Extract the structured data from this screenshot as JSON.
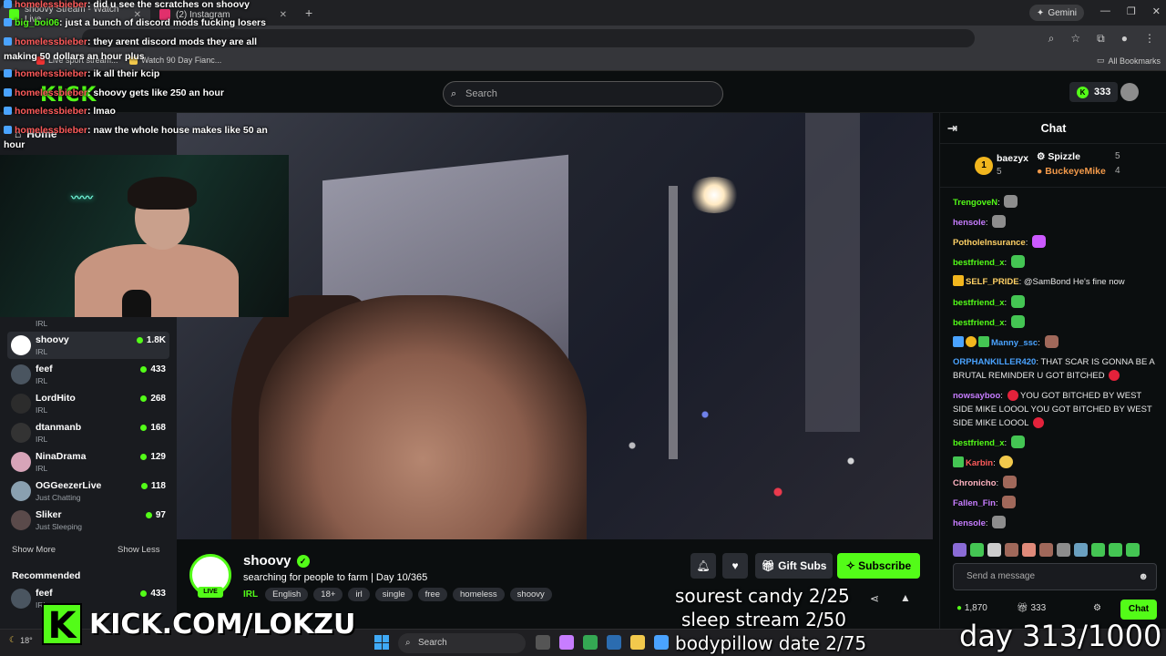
{
  "browser": {
    "tabs": [
      {
        "title": "shoovy Stream - Watch Live",
        "active": true
      },
      {
        "title": "(2) Instagram",
        "active": false
      }
    ],
    "gemini_label": "Gemini",
    "bookmarks": [
      "Live sport stream...",
      "Watch 90 Day Fianc...",
      "All Bookmarks"
    ]
  },
  "header": {
    "logo": "KICK",
    "search_placeholder": "Search",
    "points": "333"
  },
  "sidebar": {
    "home_label": "Home",
    "following": [
      {
        "name": "",
        "category": "IRL",
        "viewers": ""
      },
      {
        "name": "shoovy",
        "category": "IRL",
        "viewers": "1.8K",
        "active": true
      },
      {
        "name": "feef",
        "category": "IRL",
        "viewers": "433"
      },
      {
        "name": "LordHito",
        "category": "IRL",
        "viewers": "268"
      },
      {
        "name": "dtanmanb",
        "category": "IRL",
        "viewers": "168"
      },
      {
        "name": "NinaDrama",
        "category": "IRL",
        "viewers": "129"
      },
      {
        "name": "OGGeezerLive",
        "category": "Just Chatting",
        "viewers": "118"
      },
      {
        "name": "Sliker",
        "category": "Just Sleeping",
        "viewers": "97"
      }
    ],
    "show_more": "Show More",
    "show_less": "Show Less",
    "recommended_title": "Recommended",
    "recommended": [
      {
        "name": "feef",
        "category": "IRL",
        "viewers": "433"
      }
    ]
  },
  "overlay_chat": [
    {
      "user": "homelessbieber",
      "text": "did u see the scratches on shoovy"
    },
    {
      "user": "big_boi06",
      "text": "just a bunch of discord mods fucking losers"
    },
    {
      "user": "homelessbieber",
      "text": "they arent discord mods they are all making 50 dollars an hour plus"
    },
    {
      "user": "homelessbieber",
      "text": "ik all their kcip"
    },
    {
      "user": "homelessbieber",
      "text": "shoovy gets like 250 an hour"
    },
    {
      "user": "homelessbieber",
      "text": "lmao"
    },
    {
      "user": "homelessbieber",
      "text": "naw the whole house makes like 50 an hour"
    }
  ],
  "stream": {
    "streamer": "shoovy",
    "title": "searching for people to farm | Day 10/365",
    "live_label": "LIVE",
    "category": "IRL",
    "tags": [
      "English",
      "18+",
      "irl",
      "single",
      "free",
      "homeless",
      "shoovy"
    ],
    "gift_label": "Gift Subs",
    "subscribe_label": "Subscribe"
  },
  "overlays": {
    "sourest_candy": "sourest candy 2/25",
    "sleep_stream": "sleep stream 2/50",
    "bodypillow": "bodypillow date 2/75",
    "day_counter": "day 313/1000",
    "kick_url": "KICK.COM/LOKZU"
  },
  "chat": {
    "title": "Chat",
    "leaderboard": [
      {
        "rank": "1",
        "name": "baezyx",
        "count": "5"
      },
      {
        "rank": "",
        "name": "Spizzle",
        "count": "5"
      },
      {
        "rank": "",
        "name": "BuckeyeMike",
        "count": "4"
      }
    ],
    "messages": [
      {
        "user": "TrengoveN",
        "text": "",
        "color": "#53fc18",
        "emote": "gray"
      },
      {
        "user": "hensole",
        "text": "",
        "color": "#c77dff",
        "emote": "gray"
      },
      {
        "user": "PotholeInsurance",
        "text": "",
        "color": "#ffd166",
        "emote": "pink"
      },
      {
        "user": "bestfriend_x",
        "text": "",
        "color": "#53fc18",
        "emote": "green"
      },
      {
        "user": "SELF_PRIDE",
        "text": "@SamBond He's fine now",
        "color": "#ffd166",
        "emote": ""
      },
      {
        "user": "bestfriend_x",
        "text": "",
        "color": "#53fc18",
        "emote": "green"
      },
      {
        "user": "bestfriend_x",
        "text": "",
        "color": "#53fc18",
        "emote": "green"
      },
      {
        "user": "Manny_ssc",
        "text": "",
        "color": "#4aa3ff",
        "emote": "face"
      },
      {
        "user": "ORPHANKILLER420",
        "text": "THAT SCAR IS GONNA BE A BRUTAL REMINDER U GOT BITCHED",
        "color": "#4aa3ff",
        "emote": "red"
      },
      {
        "user": "nowsayboo",
        "text": "YOU GOT BITCHED BY WEST SIDE MIKE LOOOL YOU GOT BITCHED BY WEST SIDE MIKE LOOOL",
        "color": "#c77dff",
        "emote": "red"
      },
      {
        "user": "bestfriend_x",
        "text": "",
        "color": "#53fc18",
        "emote": "green"
      },
      {
        "user": "Karbin",
        "text": "",
        "color": "#ff5b5b",
        "emote": "yel"
      },
      {
        "user": "Chronicho",
        "text": "",
        "color": "#ffb3c1",
        "emote": "face"
      },
      {
        "user": "Fallen_Fin",
        "text": "",
        "color": "#c77dff",
        "emote": "face"
      },
      {
        "user": "hensole",
        "text": "",
        "color": "#c77dff",
        "emote": "gray"
      }
    ],
    "input_placeholder": "Send a message",
    "points": "1,870",
    "gift_count": "333",
    "chat_button": "Chat"
  },
  "taskbar": {
    "search_placeholder": "Search",
    "weather": "18°"
  },
  "colors": {
    "accent": "#53fc18",
    "background": "#0b0e0f",
    "panel": "#191b1f"
  }
}
